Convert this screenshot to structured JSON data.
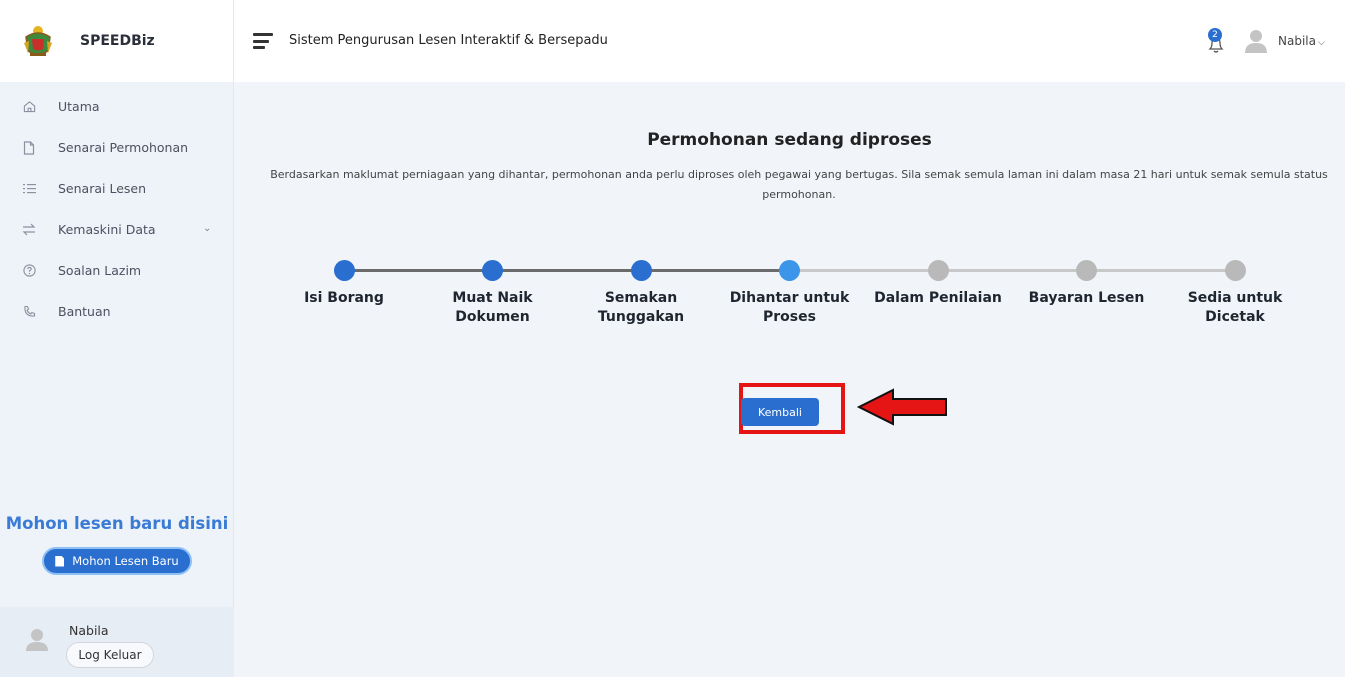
{
  "brand": {
    "name": "SPEEDBiz"
  },
  "sidebar": {
    "items": [
      {
        "label": "Utama",
        "icon": "home-icon"
      },
      {
        "label": "Senarai Permohonan",
        "icon": "document-icon"
      },
      {
        "label": "Senarai Lesen",
        "icon": "list-icon"
      },
      {
        "label": "Kemaskini Data",
        "icon": "swap-icon",
        "expandable": true
      },
      {
        "label": "Soalan Lazim",
        "icon": "help-circle-icon"
      },
      {
        "label": "Bantuan",
        "icon": "phone-icon"
      }
    ],
    "promo": {
      "title": "Mohon lesen baru disini",
      "button": "Mohon Lesen Baru"
    },
    "user": {
      "name": "Nabila",
      "logout": "Log Keluar"
    }
  },
  "header": {
    "title": "Sistem Pengurusan Lesen Interaktif & Bersepadu",
    "notification_count": "2",
    "user": "Nabila"
  },
  "main": {
    "heading": "Permohonan sedang diproses",
    "description": "Berdasarkan maklumat perniagaan yang dihantar, permohonan anda perlu diproses oleh pegawai yang bertugas. Sila semak semula laman ini dalam masa 21 hari untuk semak semula status permohonan.",
    "steps": [
      {
        "label": "Isi Borang",
        "status": "done"
      },
      {
        "label": "Muat Naik Dokumen",
        "status": "done"
      },
      {
        "label": "Semakan Tunggakan",
        "status": "done"
      },
      {
        "label": "Dihantar untuk Proses",
        "status": "current"
      },
      {
        "label": "Dalam Penilaian",
        "status": "pending"
      },
      {
        "label": "Bayaran Lesen",
        "status": "pending"
      },
      {
        "label": "Sedia untuk Dicetak",
        "status": "pending"
      }
    ],
    "back_button": "Kembali"
  },
  "colors": {
    "primary": "#2a6fcf",
    "current_step": "#3b95e8",
    "pending_step": "#b9b9b9",
    "done_track": "#6b6b6b",
    "pending_track": "#c8c8c8",
    "highlight": "#e51515"
  }
}
